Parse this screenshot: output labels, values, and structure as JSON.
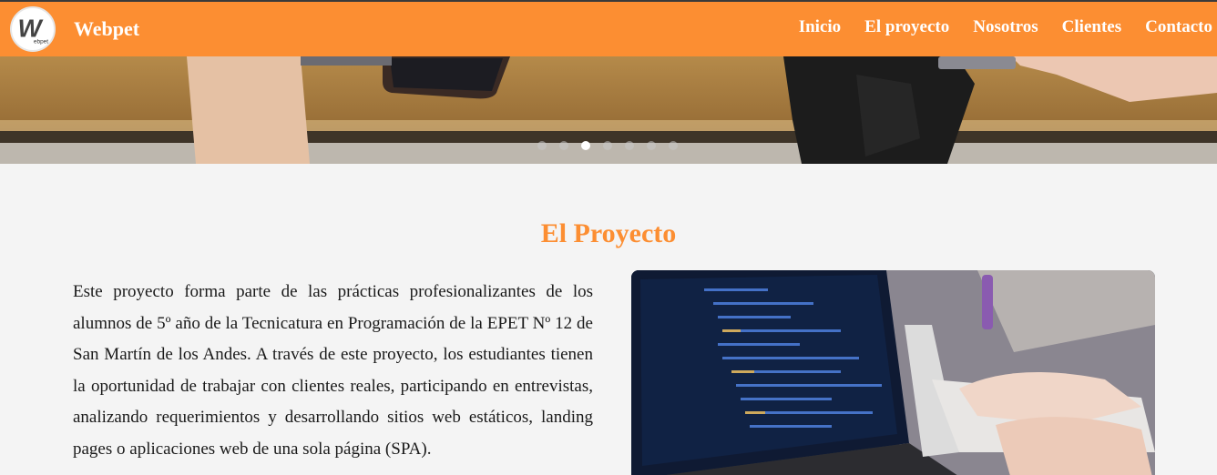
{
  "header": {
    "brand": "Webpet",
    "logo_text": "W",
    "logo_subtext": "ebpet",
    "nav": [
      {
        "label": "Inicio"
      },
      {
        "label": "El proyecto"
      },
      {
        "label": "Nosotros"
      },
      {
        "label": "Clientes"
      },
      {
        "label": "Contacto"
      }
    ]
  },
  "carousel": {
    "slide_count": 7,
    "active_index": 2
  },
  "section": {
    "title": "El Proyecto",
    "paragraph": "Este proyecto forma parte de las prácticas profesionalizantes de los alumnos de 5º año de la Tecnicatura en Programación de la EPET Nº 12 de San Martín de los Andes. A través de este proyecto, los estudiantes tienen la oportunidad de trabajar con clientes reales, participando en entrevistas, analizando requerimientos y desarrollando sitios web estáticos, landing pages o aplicaciones web de una sola página (SPA)."
  },
  "colors": {
    "accent": "#fc8e32",
    "background": "#f4f4f4",
    "text": "#1a1a1a"
  }
}
